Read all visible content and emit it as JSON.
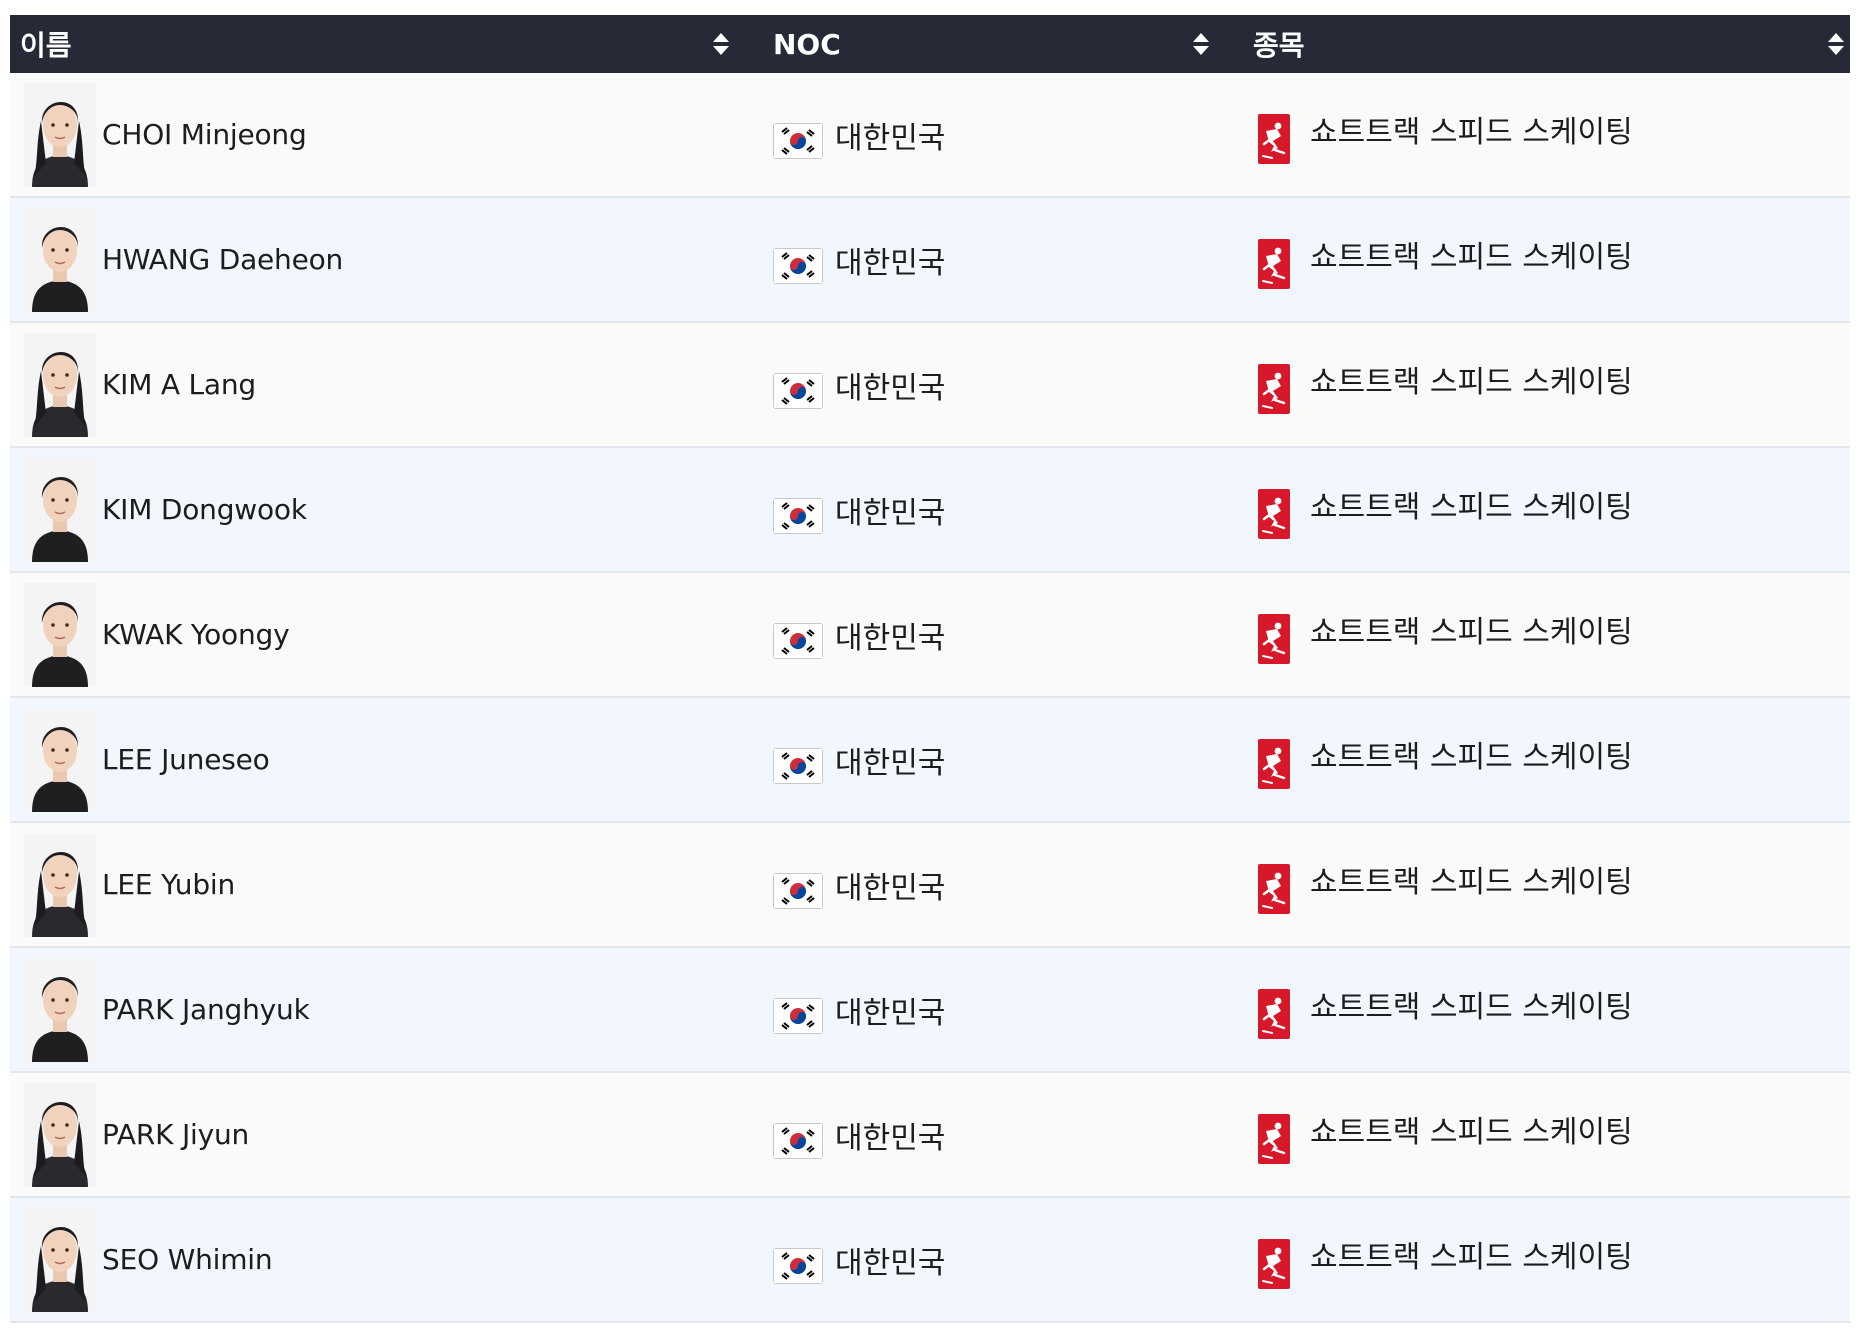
{
  "columns": {
    "name": "이름",
    "noc": "NOC",
    "sport": "종목"
  },
  "colors": {
    "header_bg": "#262a37",
    "row_odd": "#fafaf9",
    "row_even": "#f1f7fd",
    "sport_icon": "#d7182a"
  },
  "rows": [
    {
      "name": "CHOI Minjeong",
      "noc": "대한민국",
      "sport": "쇼트트랙 스피드 스케이팅",
      "avatar": "female-photo-icon"
    },
    {
      "name": "HWANG Daeheon",
      "noc": "대한민국",
      "sport": "쇼트트랙 스피드 스케이팅",
      "avatar": "male-photo-icon"
    },
    {
      "name": "KIM A Lang",
      "noc": "대한민국",
      "sport": "쇼트트랙 스피드 스케이팅",
      "avatar": "female-photo-icon"
    },
    {
      "name": "KIM Dongwook",
      "noc": "대한민국",
      "sport": "쇼트트랙 스피드 스케이팅",
      "avatar": "male-photo-icon"
    },
    {
      "name": "KWAK Yoongy",
      "noc": "대한민국",
      "sport": "쇼트트랙 스피드 스케이팅",
      "avatar": "male-photo-icon"
    },
    {
      "name": "LEE Juneseo",
      "noc": "대한민국",
      "sport": "쇼트트랙 스피드 스케이팅",
      "avatar": "male-photo-icon"
    },
    {
      "name": "LEE Yubin",
      "noc": "대한민국",
      "sport": "쇼트트랙 스피드 스케이팅",
      "avatar": "female-photo-icon"
    },
    {
      "name": "PARK Janghyuk",
      "noc": "대한민국",
      "sport": "쇼트트랙 스피드 스케이팅",
      "avatar": "male-photo-icon"
    },
    {
      "name": "PARK Jiyun",
      "noc": "대한민국",
      "sport": "쇼트트랙 스피드 스케이팅",
      "avatar": "female-photo-icon"
    },
    {
      "name": "SEO Whimin",
      "noc": "대한민국",
      "sport": "쇼트트랙 스피드 스케이팅",
      "avatar": "female-photo-icon"
    }
  ]
}
